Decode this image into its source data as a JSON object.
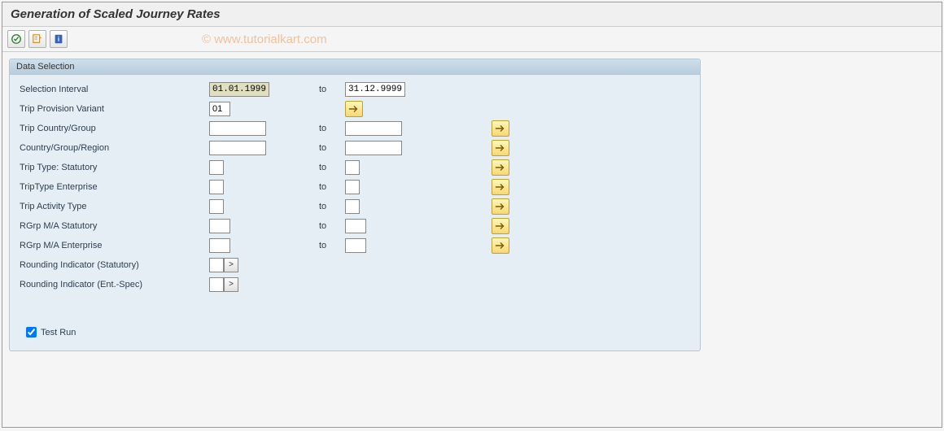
{
  "title": "Generation of Scaled Journey Rates",
  "watermark": "© www.tutorialkart.com",
  "panel_title": "Data Selection",
  "to_label": "to",
  "fields": {
    "selection_interval": {
      "label": "Selection Interval",
      "from": "01.01.1999",
      "to": "31.12.9999"
    },
    "trip_provision_variant": {
      "label": "Trip Provision Variant",
      "from": "01"
    },
    "trip_country_group": {
      "label": "Trip Country/Group",
      "from": "",
      "to": ""
    },
    "country_group_region": {
      "label": "Country/Group/Region",
      "from": "",
      "to": ""
    },
    "trip_type_statutory": {
      "label": "Trip Type: Statutory",
      "from": "",
      "to": ""
    },
    "trip_type_enterprise": {
      "label": "TripType Enterprise",
      "from": "",
      "to": ""
    },
    "trip_activity_type": {
      "label": "Trip Activity Type",
      "from": "",
      "to": ""
    },
    "rgrp_ma_statutory": {
      "label": "RGrp M/A Statutory",
      "from": "",
      "to": ""
    },
    "rgrp_ma_enterprise": {
      "label": "RGrp M/A Enterprise",
      "from": "",
      "to": ""
    },
    "rounding_statutory": {
      "label": "Rounding Indicator (Statutory)"
    },
    "rounding_entspec": {
      "label": "Rounding Indicator (Ent.-Spec)"
    }
  },
  "test_run_label": "Test Run",
  "test_run_checked": true
}
